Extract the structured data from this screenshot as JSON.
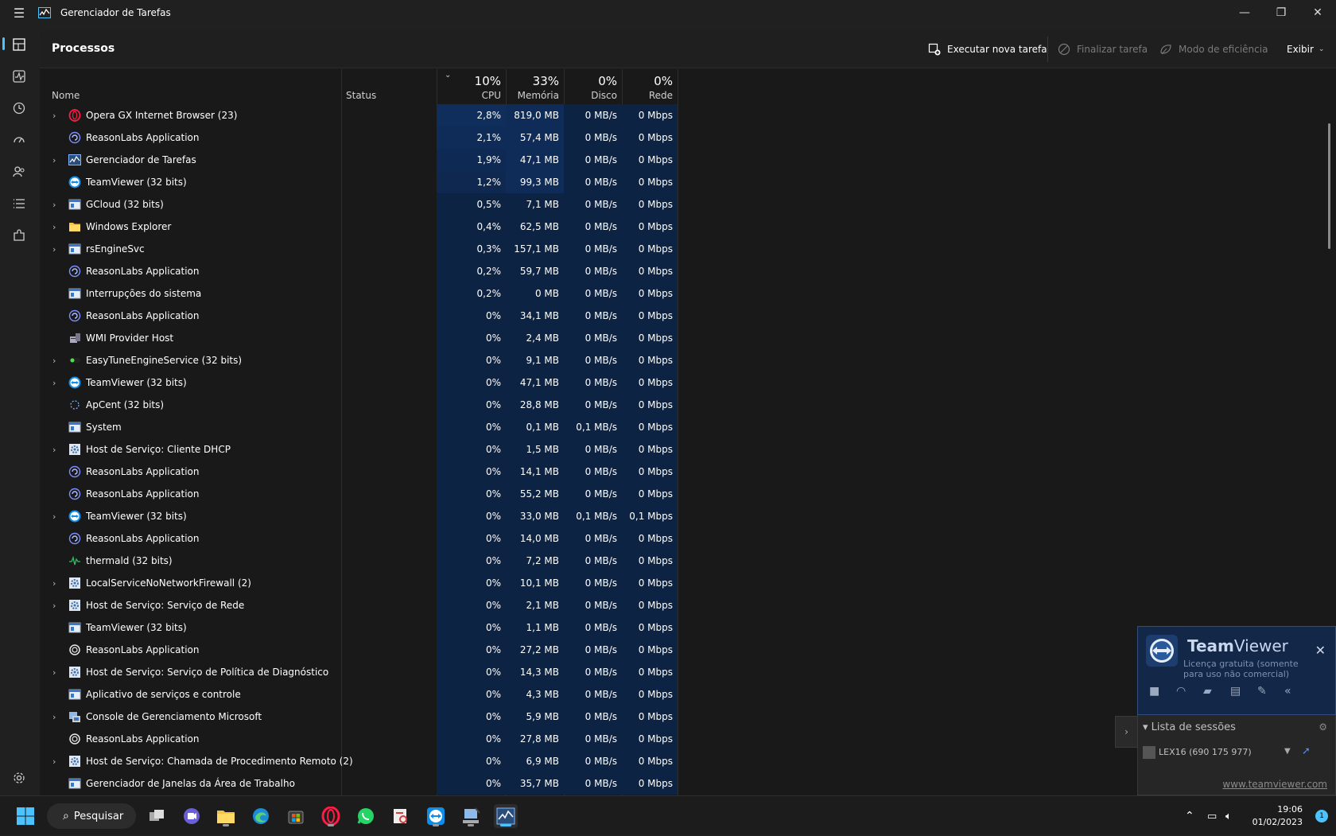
{
  "window": {
    "title": "Gerenciador de Tarefas"
  },
  "page": {
    "title": "Processos"
  },
  "commands": {
    "new_task": "Executar nova tarefa",
    "end_task": "Finalizar tarefa",
    "efficiency": "Modo de eficiência",
    "view": "Exibir"
  },
  "columns": {
    "name": "Nome",
    "status": "Status",
    "cpu_pct": "10%",
    "cpu": "CPU",
    "mem_pct": "33%",
    "mem": "Memória",
    "disk_pct": "0%",
    "disk": "Disco",
    "net_pct": "0%",
    "net": "Rede"
  },
  "processes": [
    {
      "name": "Opera GX Internet Browser (23)",
      "icon": "opera-icon",
      "expandable": true,
      "cpu": "2,8%",
      "mem": "819,0 MB",
      "disk": "0 MB/s",
      "net": "0 Mbps"
    },
    {
      "name": "ReasonLabs Application",
      "icon": "reasonlabs-icon",
      "expandable": false,
      "cpu": "2,1%",
      "mem": "57,4 MB",
      "disk": "0 MB/s",
      "net": "0 Mbps"
    },
    {
      "name": "Gerenciador de Tarefas",
      "icon": "taskmgr-icon",
      "expandable": true,
      "cpu": "1,9%",
      "mem": "47,1 MB",
      "disk": "0 MB/s",
      "net": "0 Mbps"
    },
    {
      "name": "TeamViewer (32 bits)",
      "icon": "teamviewer-icon",
      "expandable": false,
      "cpu": "1,2%",
      "mem": "99,3 MB",
      "disk": "0 MB/s",
      "net": "0 Mbps"
    },
    {
      "name": "GCloud (32 bits)",
      "icon": "window-icon",
      "expandable": true,
      "cpu": "0,5%",
      "mem": "7,1 MB",
      "disk": "0 MB/s",
      "net": "0 Mbps"
    },
    {
      "name": "Windows Explorer",
      "icon": "folder-icon",
      "expandable": true,
      "cpu": "0,4%",
      "mem": "62,5 MB",
      "disk": "0 MB/s",
      "net": "0 Mbps"
    },
    {
      "name": "rsEngineSvc",
      "icon": "window-icon",
      "expandable": true,
      "cpu": "0,3%",
      "mem": "157,1 MB",
      "disk": "0 MB/s",
      "net": "0 Mbps"
    },
    {
      "name": "ReasonLabs Application",
      "icon": "reasonlabs-icon",
      "expandable": false,
      "cpu": "0,2%",
      "mem": "59,7 MB",
      "disk": "0 MB/s",
      "net": "0 Mbps"
    },
    {
      "name": "Interrupções do sistema",
      "icon": "window-icon",
      "expandable": false,
      "cpu": "0,2%",
      "mem": "0 MB",
      "disk": "0 MB/s",
      "net": "0 Mbps"
    },
    {
      "name": "ReasonLabs Application",
      "icon": "reasonlabs-icon",
      "expandable": false,
      "cpu": "0%",
      "mem": "34,1 MB",
      "disk": "0 MB/s",
      "net": "0 Mbps"
    },
    {
      "name": "WMI Provider Host",
      "icon": "wmi-icon",
      "expandable": false,
      "cpu": "0%",
      "mem": "2,4 MB",
      "disk": "0 MB/s",
      "net": "0 Mbps"
    },
    {
      "name": "EasyTuneEngineService (32 bits)",
      "icon": "easytune-icon",
      "expandable": true,
      "cpu": "0%",
      "mem": "9,1 MB",
      "disk": "0 MB/s",
      "net": "0 Mbps"
    },
    {
      "name": "TeamViewer (32 bits)",
      "icon": "teamviewer-icon",
      "expandable": true,
      "cpu": "0%",
      "mem": "47,1 MB",
      "disk": "0 MB/s",
      "net": "0 Mbps"
    },
    {
      "name": "ApCent (32 bits)",
      "icon": "apcent-icon",
      "expandable": false,
      "cpu": "0%",
      "mem": "28,8 MB",
      "disk": "0 MB/s",
      "net": "0 Mbps"
    },
    {
      "name": "System",
      "icon": "window-icon",
      "expandable": false,
      "cpu": "0%",
      "mem": "0,1 MB",
      "disk": "0,1 MB/s",
      "net": "0 Mbps"
    },
    {
      "name": "Host de Serviço: Cliente DHCP",
      "icon": "gear-service-icon",
      "expandable": true,
      "cpu": "0%",
      "mem": "1,5 MB",
      "disk": "0 MB/s",
      "net": "0 Mbps"
    },
    {
      "name": "ReasonLabs Application",
      "icon": "reasonlabs-icon",
      "expandable": false,
      "cpu": "0%",
      "mem": "14,1 MB",
      "disk": "0 MB/s",
      "net": "0 Mbps"
    },
    {
      "name": "ReasonLabs Application",
      "icon": "reasonlabs-icon",
      "expandable": false,
      "cpu": "0%",
      "mem": "55,2 MB",
      "disk": "0 MB/s",
      "net": "0 Mbps"
    },
    {
      "name": "TeamViewer (32 bits)",
      "icon": "teamviewer-icon",
      "expandable": true,
      "cpu": "0%",
      "mem": "33,0 MB",
      "disk": "0,1 MB/s",
      "net": "0,1 Mbps"
    },
    {
      "name": "ReasonLabs Application",
      "icon": "reasonlabs-icon",
      "expandable": false,
      "cpu": "0%",
      "mem": "14,0 MB",
      "disk": "0 MB/s",
      "net": "0 Mbps"
    },
    {
      "name": "thermald (32 bits)",
      "icon": "thermald-icon",
      "expandable": false,
      "cpu": "0%",
      "mem": "7,2 MB",
      "disk": "0 MB/s",
      "net": "0 Mbps"
    },
    {
      "name": "LocalServiceNoNetworkFirewall (2)",
      "icon": "gear-service-icon",
      "expandable": true,
      "cpu": "0%",
      "mem": "10,1 MB",
      "disk": "0 MB/s",
      "net": "0 Mbps"
    },
    {
      "name": "Host de Serviço: Serviço de Rede",
      "icon": "gear-service-icon",
      "expandable": true,
      "cpu": "0%",
      "mem": "2,1 MB",
      "disk": "0 MB/s",
      "net": "0 Mbps"
    },
    {
      "name": "TeamViewer (32 bits)",
      "icon": "window-icon",
      "expandable": false,
      "cpu": "0%",
      "mem": "1,1 MB",
      "disk": "0 MB/s",
      "net": "0 Mbps"
    },
    {
      "name": "ReasonLabs Application",
      "icon": "reasonlabs-ring-icon",
      "expandable": false,
      "cpu": "0%",
      "mem": "27,2 MB",
      "disk": "0 MB/s",
      "net": "0 Mbps"
    },
    {
      "name": "Host de Serviço: Serviço de Política de Diagnóstico",
      "icon": "gear-service-icon",
      "expandable": true,
      "cpu": "0%",
      "mem": "14,3 MB",
      "disk": "0 MB/s",
      "net": "0 Mbps"
    },
    {
      "name": "Aplicativo de serviços e controle",
      "icon": "window-icon",
      "expandable": false,
      "cpu": "0%",
      "mem": "4,3 MB",
      "disk": "0 MB/s",
      "net": "0 Mbps"
    },
    {
      "name": "Console de Gerenciamento Microsoft",
      "icon": "mmc-icon",
      "expandable": true,
      "cpu": "0%",
      "mem": "5,9 MB",
      "disk": "0 MB/s",
      "net": "0 Mbps"
    },
    {
      "name": "ReasonLabs Application",
      "icon": "reasonlabs-ring-icon",
      "expandable": false,
      "cpu": "0%",
      "mem": "27,8 MB",
      "disk": "0 MB/s",
      "net": "0 Mbps"
    },
    {
      "name": "Host de Serviço: Chamada de Procedimento Remoto (2)",
      "icon": "gear-service-icon",
      "expandable": true,
      "cpu": "0%",
      "mem": "6,9 MB",
      "disk": "0 MB/s",
      "net": "0 Mbps"
    },
    {
      "name": "Gerenciador de Janelas da Área de Trabalho",
      "icon": "window-icon",
      "expandable": false,
      "cpu": "0%",
      "mem": "35,7 MB",
      "disk": "0 MB/s",
      "net": "0 Mbps"
    }
  ],
  "taskbar": {
    "search": "Pesquisar",
    "time": "19:06",
    "date": "01/02/2023",
    "notifications": "1"
  },
  "teamviewer": {
    "brand_bold": "Team",
    "brand_rest": "Viewer",
    "license": "Licença gratuita (somente para uso não comercial)",
    "sessions_header": "Lista de sessões",
    "session": "LEX16 (690 175 977)",
    "link": "www.teamviewer.com"
  },
  "colors": {
    "accent": "#4cc2ff",
    "heat_high": "#0f2e5c",
    "heat_low": "#0d2343",
    "tv_panel": "#132748"
  }
}
